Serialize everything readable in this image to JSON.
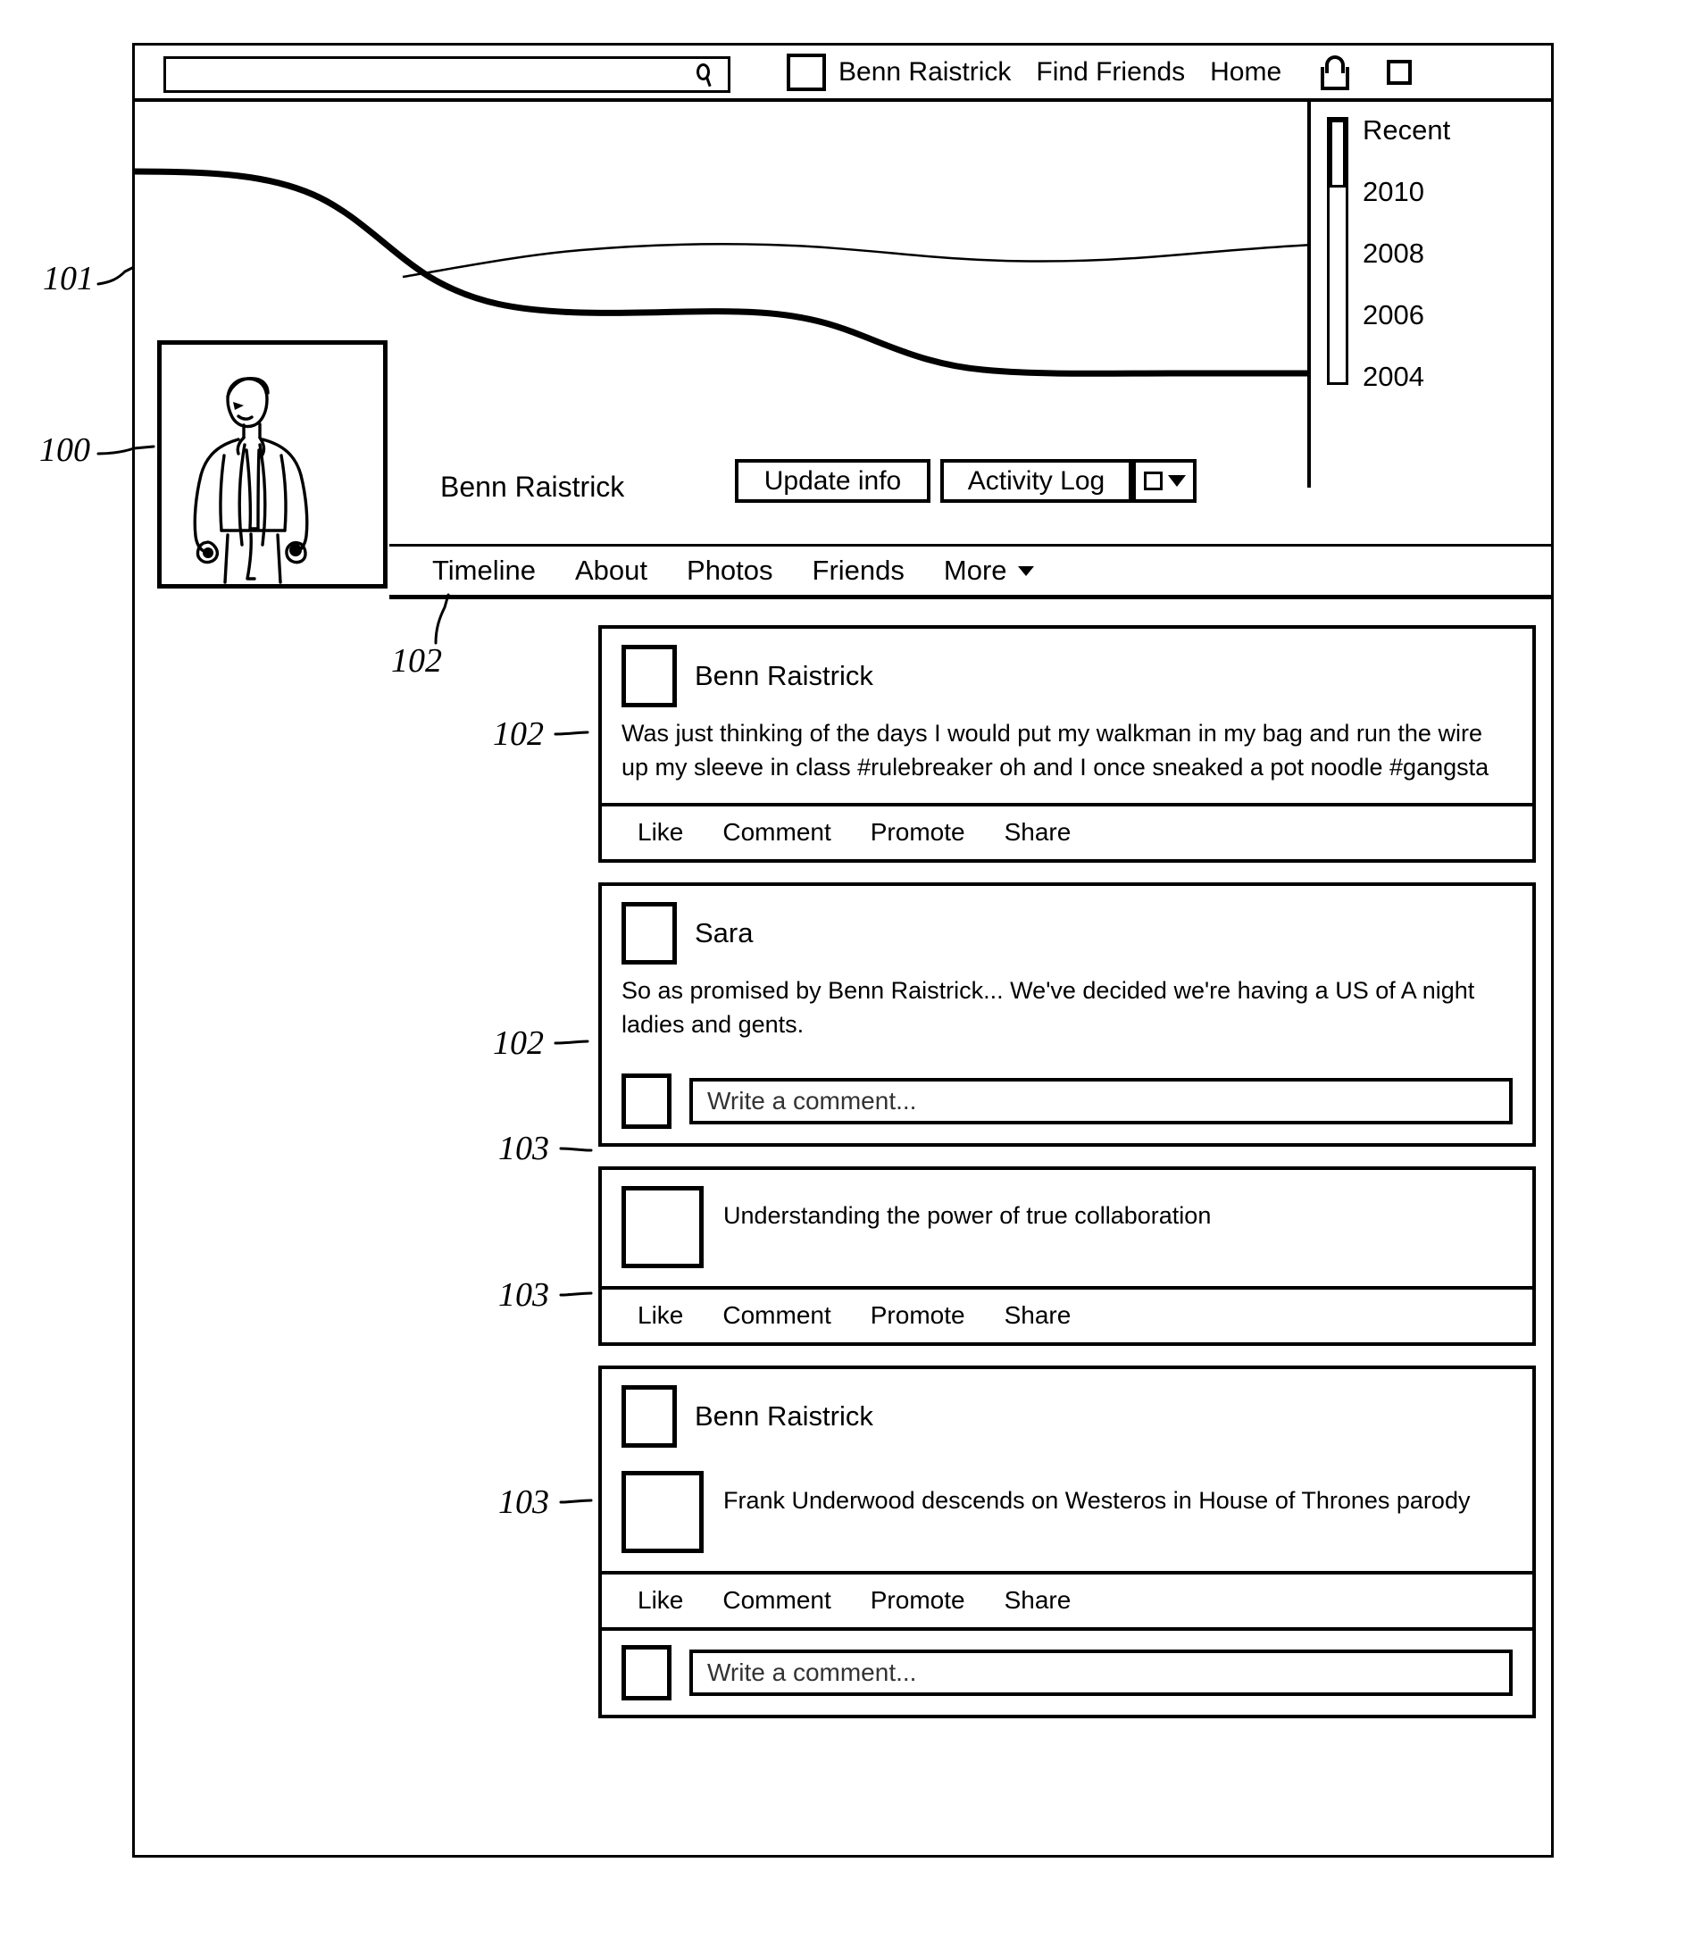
{
  "figure": {
    "callouts": [
      {
        "id": "cal-101",
        "label": "101"
      },
      {
        "id": "cal-100",
        "label": "100"
      },
      {
        "id": "cal-102-tab",
        "label": "102"
      },
      {
        "id": "cal-102-post1",
        "label": "102"
      },
      {
        "id": "cal-102-post2",
        "label": "102"
      },
      {
        "id": "cal-103-comment",
        "label": "103"
      },
      {
        "id": "cal-103-post3",
        "label": "103"
      },
      {
        "id": "cal-103-post4",
        "label": "103"
      }
    ]
  },
  "top_nav": {
    "search": {
      "value": "",
      "placeholder": "",
      "icon": "search-icon"
    },
    "user_name": "Benn Raistrick",
    "find_friends": "Find Friends",
    "home": "Home",
    "lock_icon": "lock-icon",
    "square_icon": "square-icon"
  },
  "cover": {
    "year_nav": {
      "items": [
        "Recent",
        "2010",
        "2008",
        "2006",
        "2004"
      ]
    }
  },
  "profile": {
    "name": "Benn Raistrick",
    "photo_alt": "profile-photo-line-drawing",
    "buttons": {
      "update_info": "Update info",
      "activity_log": "Activity Log",
      "settings_icon": "gear-square-icon"
    }
  },
  "tabs": [
    {
      "label": "Timeline",
      "has_caret": false
    },
    {
      "label": "About",
      "has_caret": false
    },
    {
      "label": "Photos",
      "has_caret": false
    },
    {
      "label": "Friends",
      "has_caret": false
    },
    {
      "label": "More",
      "has_caret": true
    }
  ],
  "feed": {
    "posts": [
      {
        "author": "Benn Raistrick",
        "text": "Was just thinking of the days I would put my walkman in my bag and run the wire up my sleeve in class #rulebreaker oh and I once sneaked a pot noodle #gangsta",
        "actions": [
          "Like",
          "Comment",
          "Promote",
          "Share"
        ],
        "comment_placeholder": null,
        "attachment_title": null
      },
      {
        "author": "Sara",
        "text": "So as promised by Benn Raistrick... We've decided we're having a US of A night ladies and gents.",
        "actions": null,
        "comment_placeholder": "Write a comment...",
        "attachment_title": null
      },
      {
        "author": null,
        "text": null,
        "actions": [
          "Like",
          "Comment",
          "Promote",
          "Share"
        ],
        "comment_placeholder": null,
        "attachment_title": "Understanding the power of true collaboration"
      },
      {
        "author": "Benn Raistrick",
        "text": null,
        "actions": [
          "Like",
          "Comment",
          "Promote",
          "Share"
        ],
        "comment_placeholder": "Write a comment...",
        "attachment_title": "Frank Underwood descends on Westeros in House of Thrones parody"
      }
    ]
  }
}
